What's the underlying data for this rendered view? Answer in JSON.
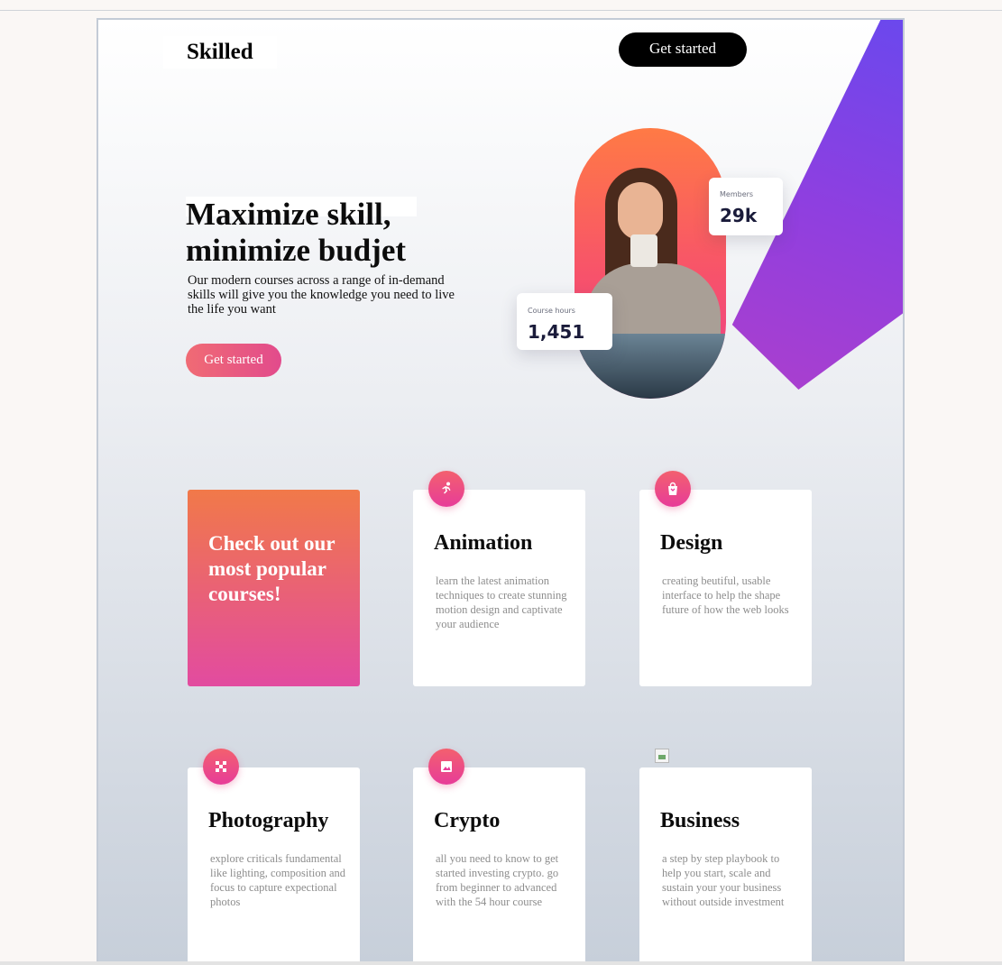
{
  "header": {
    "logo": "Skilled",
    "cta_label": "Get started"
  },
  "hero": {
    "title": "Maximize skill, minimize budjet",
    "subtitle": "Our modern courses across a range of in-demand skills will give you the knowledge you need to live the life you want",
    "cta_label": "Get started"
  },
  "stats": {
    "members_label": "Members",
    "members_value": "29k",
    "hours_label": "Course hours",
    "hours_value": "1,451"
  },
  "promo": {
    "text": "Check out our most popular courses!"
  },
  "courses": [
    {
      "title": "Animation",
      "desc": "learn the latest animation techniques to create stunning motion design and captivate your audience",
      "icon": "running-icon"
    },
    {
      "title": "Design",
      "desc": "creating beutiful, usable interface to help the shape future of how the web looks",
      "icon": "shopping-bag-icon"
    },
    {
      "title": "Photography",
      "desc": "explore criticals fundamental like lighting, composition and focus to capture expectional photos",
      "icon": "checker-icon"
    },
    {
      "title": "Crypto",
      "desc": "all you need to know to get started investing crypto. go from beginner to advanced with the 54 hour course",
      "icon": "image-icon"
    },
    {
      "title": "Business",
      "desc": "a step by step playbook to help you start, scale and sustain your your business without outside investment",
      "icon": "broken-image-icon"
    }
  ],
  "colors": {
    "accent_start": "#f06b74",
    "accent_end": "#e24b8c",
    "diagonal_start": "#5b4cf3",
    "diagonal_end": "#c13fbf"
  }
}
